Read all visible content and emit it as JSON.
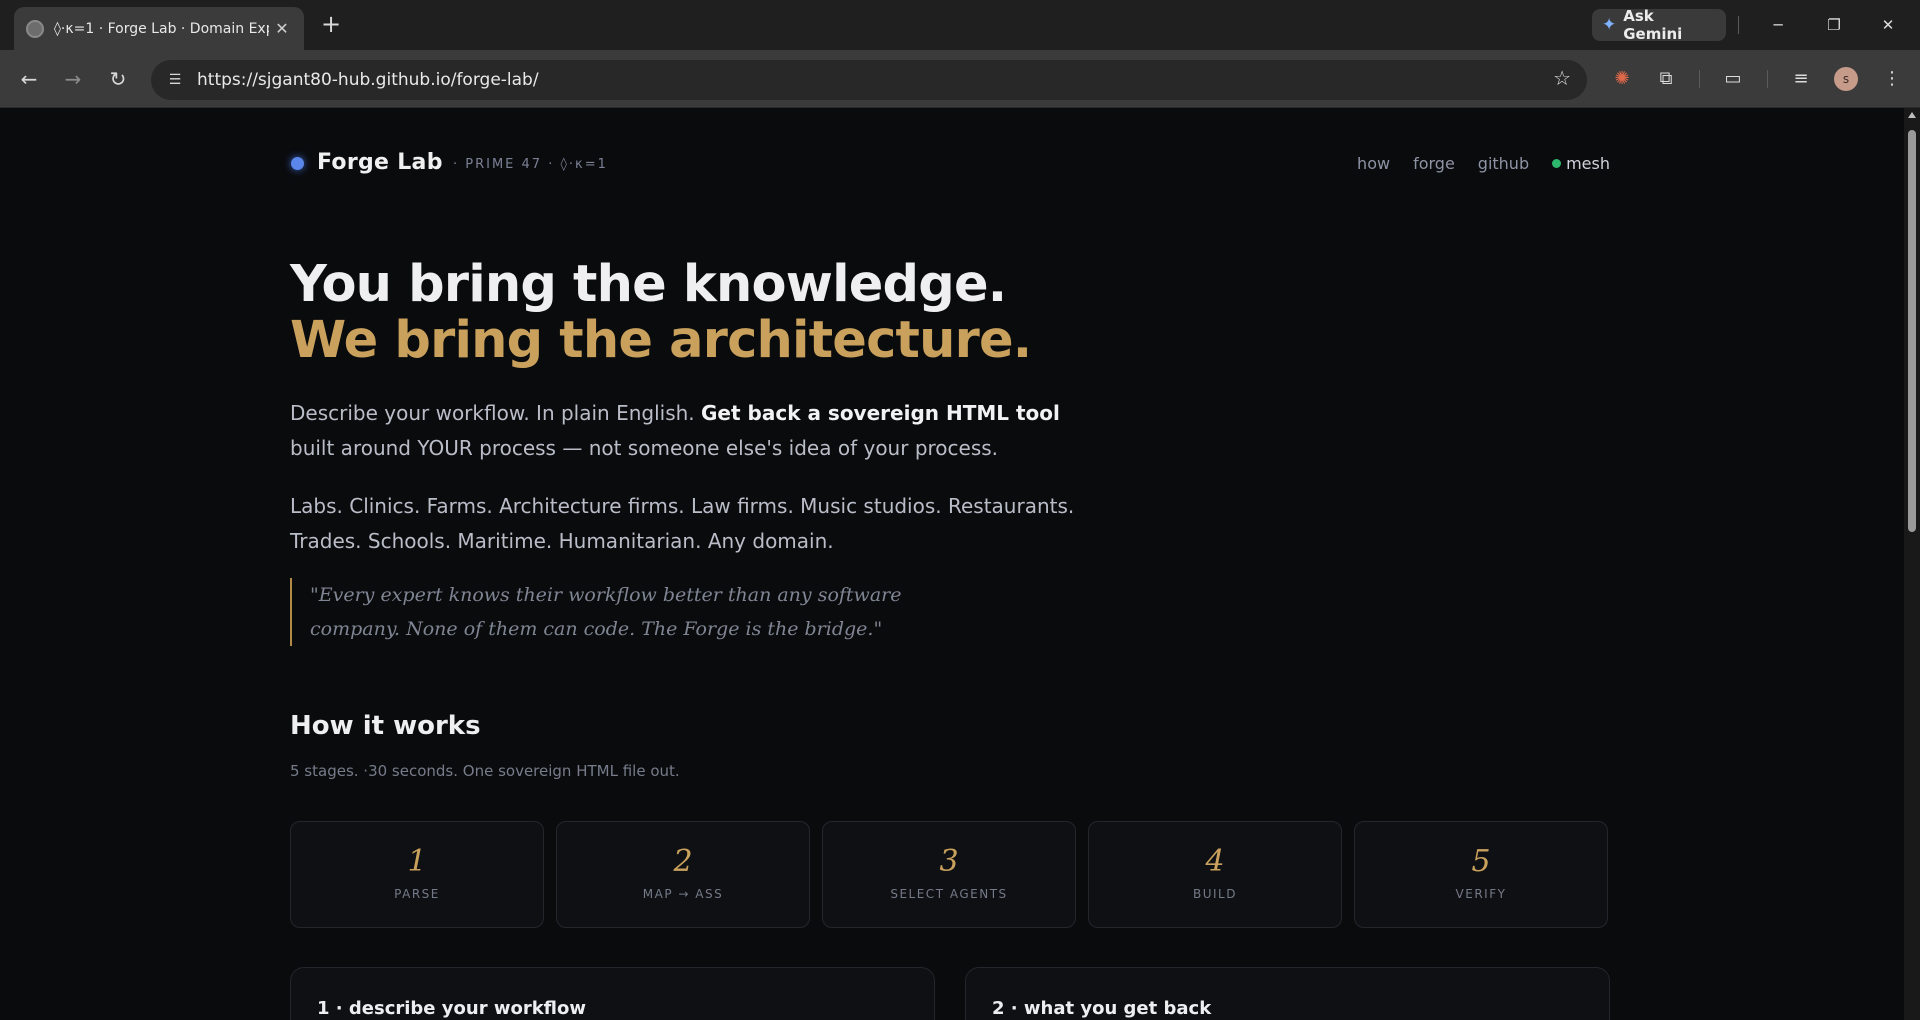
{
  "browser": {
    "tab_title": "◊·κ=1 · Forge Lab · Domain Exp",
    "tab_close": "✕",
    "new_tab": "+",
    "ask_gemini": "Ask Gemini",
    "url": "https://sjgant80-hub.github.io/forge-lab/",
    "profile_initial": "s"
  },
  "header": {
    "brand": "Forge Lab",
    "tagline": "· PRIME 47 · ◊·κ=1",
    "nav": [
      "how",
      "forge",
      "github"
    ],
    "mesh_label": "mesh"
  },
  "hero": {
    "line1": "You bring the knowledge.",
    "line2": "We bring the architecture.",
    "lead_plain_1": "Describe your workflow. In plain English. ",
    "lead_strong": "Get back a sovereign HTML tool",
    "lead_plain_2": "built around YOUR process — not someone else's idea of your process.",
    "domains": "Labs. Clinics. Farms. Architecture firms. Law firms. Music studios. Restaurants. Trades. Schools. Maritime. Humanitarian. Any domain.",
    "quote": "\"Every expert knows their workflow better than any software company. None of them can code. The Forge is the bridge.\""
  },
  "how": {
    "title": "How it works",
    "subtitle": "5 stages. ·30 seconds. One sovereign HTML file out.",
    "stages": [
      {
        "num": "1",
        "label": "PARSE"
      },
      {
        "num": "2",
        "label": "MAP → ASS"
      },
      {
        "num": "3",
        "label": "SELECT AGENTS"
      },
      {
        "num": "4",
        "label": "BUILD"
      },
      {
        "num": "5",
        "label": "VERIFY"
      }
    ]
  },
  "cards": [
    {
      "title": "1 · describe your workflow"
    },
    {
      "title": "2 · what you get back"
    }
  ],
  "colors": {
    "accent_gold": "#c9a15c",
    "brand_blue": "#5b86ea",
    "mesh_green": "#2eb86e",
    "background": "#0a0b0d"
  }
}
